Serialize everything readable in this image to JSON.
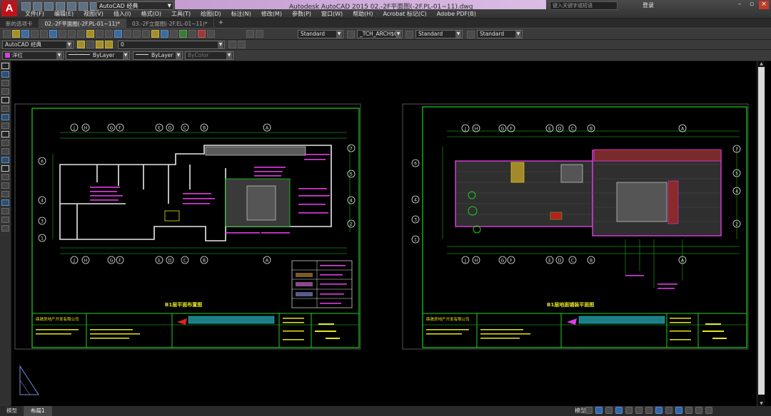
{
  "app": {
    "logo": "A",
    "title": "Autodesk AutoCAD 2015    02.-2F平面图(-2F.PL-01~11).dwg",
    "workspace": "AutoCAD 经典",
    "search_placeholder": "键入关键字或短语",
    "login": "登录"
  },
  "menu": [
    "文件(F)",
    "编辑(E)",
    "视图(V)",
    "插入(I)",
    "格式(O)",
    "工具(T)",
    "绘图(D)",
    "标注(N)",
    "修改(M)",
    "参数(P)",
    "窗口(W)",
    "帮助(H)",
    "Acrobat 标记(C)",
    "Adobe PDF(B)"
  ],
  "tabs": [
    {
      "label": "新的选项卡",
      "active": false
    },
    {
      "label": "02.-2F平面图(-2F.PL-01~11)*",
      "active": true
    },
    {
      "label": "03.-2F立面图(-2F.EL-01~11)*",
      "active": false
    }
  ],
  "tab_add": "+",
  "toolbar": {
    "text_style": "Standard",
    "dim_style": "_TCH_ARCH$0",
    "table_style": "Standard",
    "mleader_style": "Standard",
    "workspace_combo": "AutoCAD 经典",
    "layer_combo": "0",
    "layer_color_name": "洋红",
    "layer_color": "#c64ad0",
    "linetype": "ByLayer",
    "lineweight": "ByLayer",
    "plot_style": "ByColor"
  },
  "layout_tabs": [
    {
      "label": "模型",
      "active": false
    },
    {
      "label": "布局1",
      "active": true
    }
  ],
  "status": {
    "model_label": "模型"
  },
  "colors": {
    "green": "#1fd11f",
    "magenta": "#e23be2",
    "yellow": "#e6e61a",
    "cyan": "#22cfd6",
    "white": "#e8e8e8",
    "red": "#e22222"
  },
  "drawing": {
    "left_sheet": {
      "grid_top": [
        "J",
        "H",
        "G",
        "F",
        "E",
        "D",
        "C",
        "B",
        "A"
      ],
      "grid_bottom": [
        "J",
        "H",
        "G",
        "F",
        "E",
        "D",
        "C",
        "B",
        "A"
      ],
      "grid_left": [
        "6",
        "4",
        "3",
        "1"
      ],
      "grid_right": [
        "7",
        "5",
        "4",
        "2"
      ],
      "caption": "B1层平面布置图",
      "company": "鼎晟房地产开发有限公司"
    },
    "right_sheet": {
      "grid_top": [
        "J",
        "H",
        "G",
        "F",
        "E",
        "D",
        "C",
        "B",
        "A"
      ],
      "grid_bottom": [
        "J",
        "H",
        "G",
        "F",
        "E",
        "D",
        "C",
        "B",
        "A"
      ],
      "grid_left": [
        "6",
        "4",
        "3",
        "1"
      ],
      "grid_right": [
        "7",
        "5",
        "4",
        "2"
      ],
      "caption": "B1层地面铺装平面图",
      "company": "鼎晟房地产开发有限公司"
    }
  }
}
